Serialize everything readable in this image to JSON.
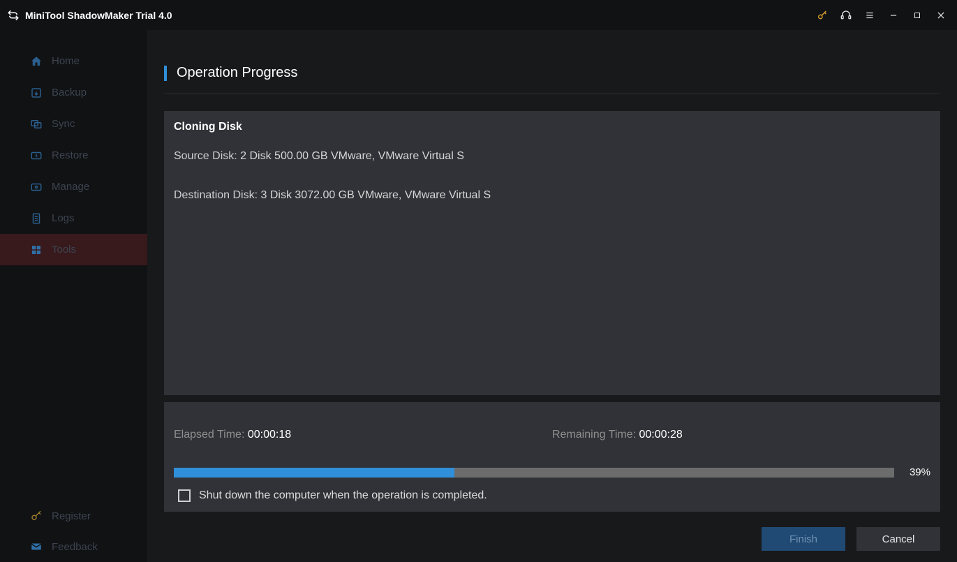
{
  "titlebar": {
    "title": "MiniTool ShadowMaker Trial 4.0"
  },
  "sidebar": {
    "items": [
      {
        "label": "Home"
      },
      {
        "label": "Backup"
      },
      {
        "label": "Sync"
      },
      {
        "label": "Restore"
      },
      {
        "label": "Manage"
      },
      {
        "label": "Logs"
      },
      {
        "label": "Tools"
      }
    ],
    "footer": [
      {
        "label": "Register"
      },
      {
        "label": "Feedback"
      }
    ]
  },
  "main": {
    "heading": "Operation Progress",
    "operation_title": "Cloning Disk",
    "source_label": "Source Disk:",
    "source_value": "2 Disk 500.00 GB VMware, VMware Virtual S",
    "dest_label": "Destination Disk:",
    "dest_value": "3 Disk 3072.00 GB VMware, VMware Virtual S",
    "elapsed_label": "Elapsed Time:",
    "elapsed_value": "00:00:18",
    "remaining_label": "Remaining Time:",
    "remaining_value": "00:00:28",
    "progress_percent": 39,
    "progress_text": "39%",
    "shutdown_label": "Shut down the computer when the operation is completed.",
    "finish_label": "Finish",
    "cancel_label": "Cancel"
  }
}
